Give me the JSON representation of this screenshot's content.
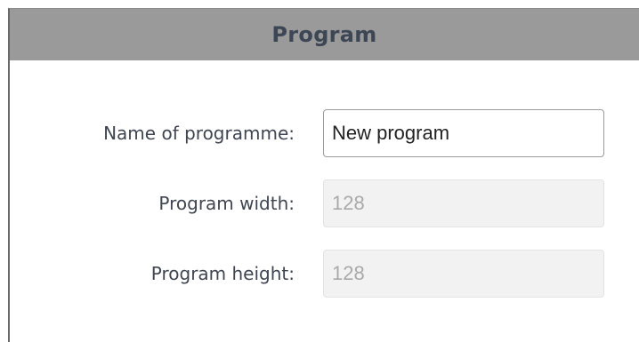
{
  "panel": {
    "title": "Program"
  },
  "fields": {
    "name": {
      "label": "Name of programme:",
      "value": "New program"
    },
    "width": {
      "label": "Program width:",
      "value": "128"
    },
    "height": {
      "label": "Program height:",
      "value": "128"
    }
  },
  "colors": {
    "header_background": "#9a9a9a",
    "title_text": "#3c4654",
    "label_text": "#3f4652",
    "disabled_field_background": "#f2f2f2"
  }
}
